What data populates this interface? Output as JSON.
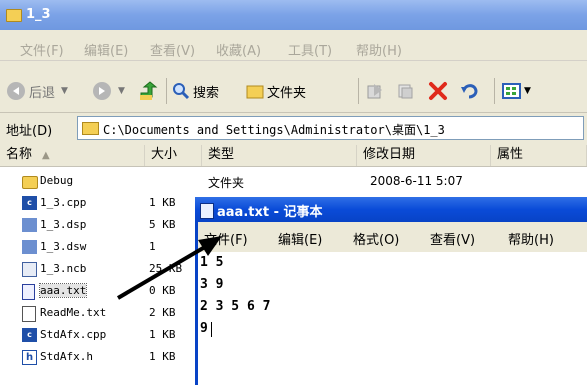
{
  "window": {
    "title": "1_3"
  },
  "menu": [
    "文件(F)",
    "编辑(E)",
    "查看(V)",
    "收藏(A)",
    "工具(T)",
    "帮助(H)"
  ],
  "toolbar": {
    "back": "后退",
    "search": "搜索",
    "folders": "文件夹"
  },
  "address": {
    "label": "地址(D)",
    "path": "C:\\Documents and Settings\\Administrator\\桌面\\1_3"
  },
  "columns": [
    "名称",
    "大小",
    "类型",
    "修改日期",
    "属性"
  ],
  "files": [
    {
      "name": "Debug",
      "size": "",
      "type": "文件夹",
      "date": "2008-6-11 5:07",
      "icon": "folder-icon"
    },
    {
      "name": "1_3.cpp",
      "size": "1 KB",
      "icon": "cpp-file-icon"
    },
    {
      "name": "1_3.dsp",
      "size": "5 KB",
      "icon": "dsp-file-icon"
    },
    {
      "name": "1_3.dsw",
      "size": "1",
      "icon": "dsw-file-icon"
    },
    {
      "name": "1_3.ncb",
      "size": "25 KB",
      "icon": "ncb-file-icon"
    },
    {
      "name": "aaa.txt",
      "size": "0 KB",
      "icon": "text-file-icon"
    },
    {
      "name": "ReadMe.txt",
      "size": "2 KB",
      "icon": "text-file-icon"
    },
    {
      "name": "StdAfx.cpp",
      "size": "1 KB",
      "icon": "cpp-file-icon"
    },
    {
      "name": "StdAfx.h",
      "size": "1 KB",
      "icon": "header-file-icon"
    }
  ],
  "notepad": {
    "title": "aaa.txt - 记事本",
    "menu": [
      "文件(F)",
      "编辑(E)",
      "格式(O)",
      "查看(V)",
      "帮助(H)"
    ],
    "lines": [
      "1 5",
      "3 9",
      "2 3 5 6 7",
      "9"
    ]
  }
}
